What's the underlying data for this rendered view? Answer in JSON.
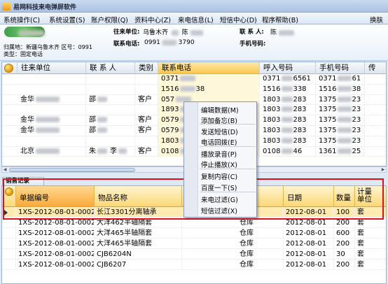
{
  "app": {
    "title": "易网科技来电弹屏软件"
  },
  "menu": [
    "系统操作(C)",
    "系统设置(S)",
    "账户权限(Q)",
    "资料中心(Z)",
    "来电信息(L)",
    "短信中心(D)",
    "程序帮助(B)",
    "换肤"
  ],
  "caller_info": {
    "location_line1": "归属地：新疆乌鲁木齐 区号：0991",
    "location_line2": "类型：固定电话",
    "unit_label": "往来单位:",
    "unit_value": "乌鲁木齐",
    "unit_suffix": "陈",
    "contact_label": "联 系 人:",
    "contact_value": "陈",
    "phone_label": "联系电话:",
    "phone_prefix": "0991",
    "phone_suffix": "3790",
    "mobile_label": "手机号码:"
  },
  "customer_grid": {
    "columns": [
      "往来单位",
      "联 系 人",
      "类别",
      "联系电话",
      "呼入号码",
      "手机号码",
      "传"
    ],
    "rows": [
      {
        "unit": "",
        "contact": "",
        "contact2": "",
        "type": "",
        "phone": "0371",
        "phone_tail": "",
        "inbound": "0371",
        "inbound_tail": "6561",
        "mobile": "0371",
        "mobile_tail": "61"
      },
      {
        "unit": "",
        "contact": "",
        "contact2": "",
        "type": "",
        "phone": "1516",
        "phone_tail": "38",
        "inbound": "1516",
        "inbound_tail": "338",
        "mobile": "1516",
        "mobile_tail": "38"
      },
      {
        "unit": "金华",
        "contact": "邵",
        "contact2": "",
        "type": "客户",
        "phone": "057",
        "phone_tail": "",
        "inbound": "1803",
        "inbound_tail": "283",
        "mobile": "1375",
        "mobile_tail": "23"
      },
      {
        "unit": "",
        "contact": "",
        "contact2": "",
        "type": "",
        "phone": "1893",
        "phone_tail": "",
        "inbound": "1803",
        "inbound_tail": "283",
        "mobile": "1375",
        "mobile_tail": "23"
      },
      {
        "unit": "金华",
        "contact": "邵",
        "contact2": "",
        "type": "客户",
        "phone": "0579",
        "phone_tail": "",
        "inbound": "1803",
        "inbound_tail": "283",
        "mobile": "1375",
        "mobile_tail": "23"
      },
      {
        "unit": "金华",
        "contact": "邵",
        "contact2": "",
        "type": "客户",
        "phone": "0579",
        "phone_tail": "",
        "inbound": "1803",
        "inbound_tail": "283",
        "mobile": "1375",
        "mobile_tail": "23"
      },
      {
        "unit": "",
        "contact": "",
        "contact2": "",
        "type": "",
        "phone": "1803",
        "phone_tail": "",
        "inbound": "1803",
        "inbound_tail": "283",
        "mobile": "1375",
        "mobile_tail": "23"
      },
      {
        "unit": "北京",
        "contact": "朱",
        "contact2": "李",
        "type": "客户",
        "phone": "0108",
        "phone_tail": "",
        "inbound": "0108",
        "inbound_tail": "46",
        "mobile": "1361",
        "mobile_tail": "25"
      }
    ]
  },
  "sales": {
    "tab_label": "销售记录",
    "columns": [
      "单据编号",
      "物品名称",
      "",
      "日期",
      "数量",
      "计量单位"
    ],
    "rows": [
      {
        "no": "1XS-2012-08-01-0002",
        "name": "长江3301分离轴承",
        "store": "",
        "date": "2012-08-01",
        "qty": "100",
        "unit": "套"
      },
      {
        "no": "1XS-2012-08-01-0002",
        "name": "大洋462半轴隔套",
        "store": "仓库",
        "date": "2012-08-01",
        "qty": "200",
        "unit": "套"
      },
      {
        "no": "1XS-2012-08-01-0002",
        "name": "大洋465半轴隔套",
        "store": "仓库",
        "date": "2012-08-01",
        "qty": "600",
        "unit": "套"
      },
      {
        "no": "1XS-2012-08-01-0002",
        "name": "大洋465半轴隔套",
        "store": "仓库",
        "date": "2012-08-01",
        "qty": "200",
        "unit": "套"
      },
      {
        "no": "1XS-2012-08-01-0002",
        "name": "CJB6204N",
        "store": "仓库",
        "date": "2012-08-01",
        "qty": "30",
        "unit": "套"
      },
      {
        "no": "1XS-2012-08-01-0002",
        "name": "CJB6207",
        "store": "仓库",
        "date": "2012-08-01",
        "qty": "200",
        "unit": "套"
      }
    ]
  },
  "context_menu": [
    "编辑数据(M)",
    "添加备忘(B)",
    "发送短信(D)",
    "电话回拨(E)",
    "播放录音(P)",
    "停止播放(X)",
    "复制内容(C)",
    "百度一下(S)",
    "来电过滤(G)",
    "短信过滤(X)"
  ]
}
